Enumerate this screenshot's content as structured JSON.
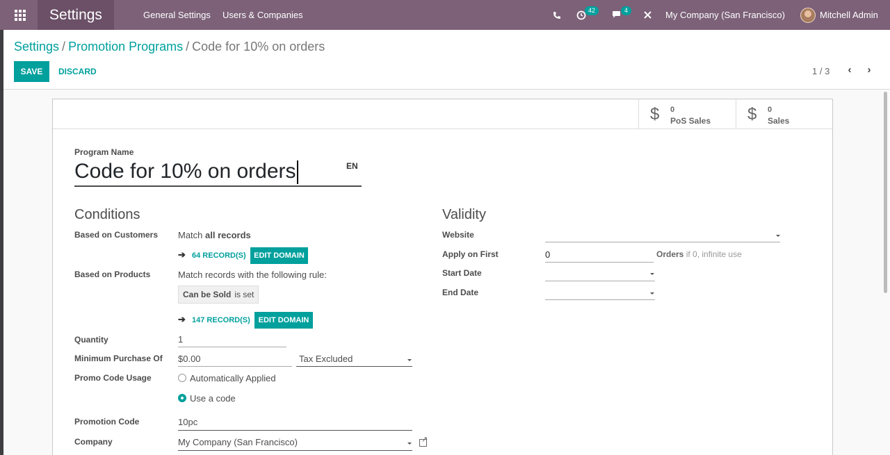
{
  "navbar": {
    "brand": "Settings",
    "menu": [
      "General Settings",
      "Users & Companies"
    ],
    "activity_count": "42",
    "message_count": "4",
    "company": "My Company (San Francisco)",
    "user": "Mitchell Admin"
  },
  "breadcrumb": {
    "root": "Settings",
    "sep1": "/",
    "parent": "Promotion Programs",
    "sep2": "/",
    "current": "Code for 10% on orders"
  },
  "actions": {
    "save": "SAVE",
    "discard": "DISCARD"
  },
  "pager": {
    "value": "1 / 3"
  },
  "stats": [
    {
      "value": "0",
      "label": "PoS Sales",
      "icon": "dollar-icon"
    },
    {
      "value": "0",
      "label": "Sales",
      "icon": "dollar-icon"
    }
  ],
  "program": {
    "name_label": "Program Name",
    "name": "Code for 10% on orders",
    "lang": "EN"
  },
  "conditions": {
    "title": "Conditions",
    "customers_label": "Based on Customers",
    "customers_match_prefix": "Match",
    "customers_match_bold": "all records",
    "customers_records": "64 RECORD(S)",
    "edit_domain": "EDIT DOMAIN",
    "products_label": "Based on Products",
    "products_rule": "Match records with the following rule:",
    "rule_field": "Can be Sold",
    "rule_op": "is set",
    "products_records": "147 RECORD(S)",
    "quantity_label": "Quantity",
    "quantity": "1",
    "min_purchase_label": "Minimum Purchase Of",
    "currency": "$",
    "min_purchase": "0.00",
    "tax_mode": "Tax Excluded",
    "promo_usage_label": "Promo Code Usage",
    "option_auto": "Automatically Applied",
    "option_code": "Use a code",
    "selected_option": "Use a code",
    "promo_code_label": "Promotion Code",
    "promo_code": "10pc",
    "company_label": "Company",
    "company": "My Company (San Francisco)"
  },
  "validity": {
    "title": "Validity",
    "website_label": "Website",
    "website": "",
    "apply_first_label": "Apply on First",
    "apply_first": "0",
    "orders_suffix": "Orders",
    "orders_hint": "if 0, infinite use",
    "start_label": "Start Date",
    "start": "",
    "end_label": "End Date",
    "end": ""
  },
  "colors": {
    "navbar": "#7c6178",
    "accent": "#00a09d"
  }
}
